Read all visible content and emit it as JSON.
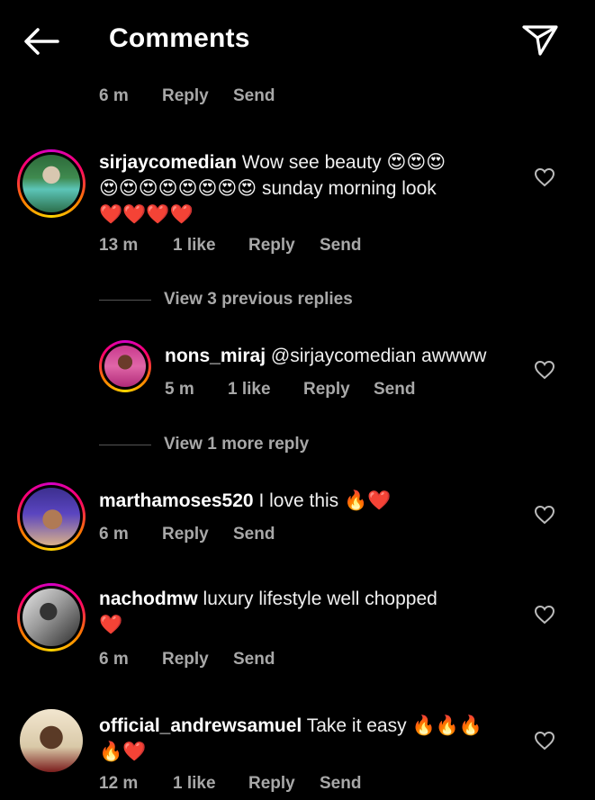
{
  "header": {
    "title": "Comments"
  },
  "top_meta": {
    "time": "6 m",
    "reply": "Reply",
    "send": "Send"
  },
  "comments": [
    {
      "username": "sirjaycomedian",
      "text_1": "Wow see beauty",
      "emoji_1": "😍😍😍",
      "emoji_2": "😍😍😍😍😍😍😍😍",
      "text_2": "sunday morning look",
      "emoji_3": "❤️❤️❤️❤️",
      "time": "13 m",
      "likes": "1 like",
      "reply": "Reply",
      "send": "Send"
    },
    {
      "username": "nons_miraj",
      "text_1": "@sirjaycomedian awwww",
      "time": "5 m",
      "likes": "1 like",
      "reply": "Reply",
      "send": "Send"
    },
    {
      "username": "marthamoses520",
      "text_1": "I love this",
      "emoji_1": "🔥❤️",
      "time": "6 m",
      "reply": "Reply",
      "send": "Send"
    },
    {
      "username": "nachodmw",
      "text_1": "luxury lifestyle well chopped",
      "emoji_1": "❤️",
      "time": "6 m",
      "reply": "Reply",
      "send": "Send"
    },
    {
      "username": "official_andrewsamuel",
      "text_1": "Take it easy",
      "emoji_1": "🔥🔥🔥",
      "emoji_2": "🔥❤️",
      "time": "12 m",
      "likes": "1 like",
      "reply": "Reply",
      "send": "Send"
    }
  ],
  "view_previous": "View 3 previous replies",
  "view_more": "View 1 more reply",
  "icons": {
    "back": "arrow-left-icon",
    "direct": "paper-plane-icon",
    "like": "heart-outline-icon"
  },
  "colors": {
    "background": "#000000",
    "text": "#f5f5f5",
    "meta": "#a8a8a8",
    "heart": "#ff3040",
    "story_ring": "#ff0069"
  }
}
